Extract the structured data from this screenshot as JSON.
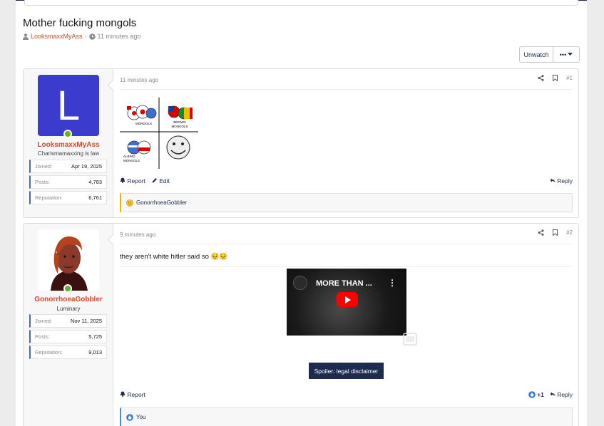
{
  "thread": {
    "title": "Mother fucking mongols",
    "starter": "LooksmaxxMyAss",
    "separator": "·",
    "time": "11 minutes ago",
    "unwatch_label": "Unwatch",
    "more_label": "•••"
  },
  "posts": [
    {
      "avatar_letter": "L",
      "username": "LooksmaxxMyAss",
      "user_title": "Charismamaxxing is law",
      "stats": [
        {
          "key": "Joined:",
          "value": "Apr 19, 2025"
        },
        {
          "key": "Posts:",
          "value": "4,783"
        },
        {
          "key": "Reputation:",
          "value": "6,761"
        }
      ],
      "time": "11 minutes ago",
      "number": "#1",
      "meme_labels": [
        "MONGOLS",
        "BROWN MONGOLS",
        "ALBINO MONGOLS"
      ],
      "report_label": "Report",
      "edit_label": "Edit",
      "reply_label": "Reply",
      "reaction_user": "GonorrhoeaGobbler"
    },
    {
      "username": "GonorrhoeaGobbler",
      "user_title": "Luminary",
      "stats": [
        {
          "key": "Joined:",
          "value": "Nov 11, 2025"
        },
        {
          "key": "Posts:",
          "value": "5,725"
        },
        {
          "key": "Reputation:",
          "value": "9,013"
        }
      ],
      "time": "9 minutes ago",
      "number": "#2",
      "text": "they aren't white hitler said so 😣😣",
      "video_title": "MORE THAN ...",
      "spoiler_label": "Spoiler: legal disclaimer",
      "report_label": "Report",
      "reaction_count": "+1",
      "reply_label": "Reply",
      "reaction_user": "You"
    }
  ],
  "colors": {
    "accent": "#1c2b4f",
    "username": "#d8492a",
    "online": "#63b132",
    "avatar_bg": "#3b3bce"
  }
}
